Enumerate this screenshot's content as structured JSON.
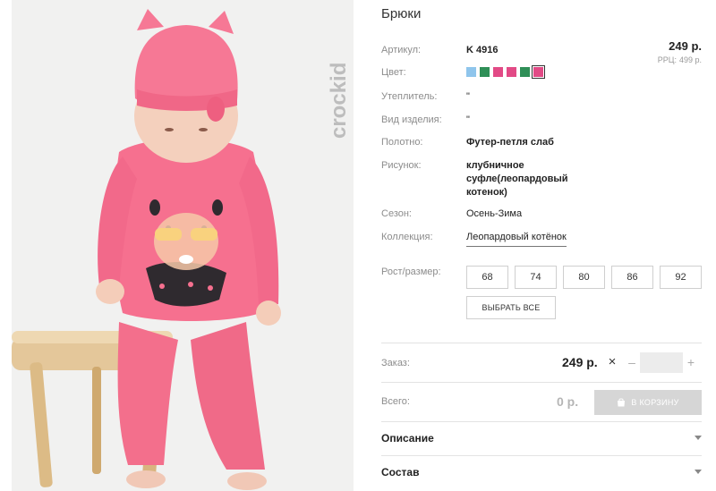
{
  "product": {
    "title": "Брюки",
    "price": "249 р.",
    "rrp_label": "РРЦ:",
    "rrp_value": "499 р."
  },
  "attributes": [
    {
      "label": "Артикул:",
      "value": "K 4916"
    },
    {
      "label": "Цвет:",
      "value": ""
    },
    {
      "label": "Утеплитель:",
      "value": "\""
    },
    {
      "label": "Вид изделия:",
      "value": "\""
    },
    {
      "label": "Полотно:",
      "value": "Футер-петля слаб"
    },
    {
      "label": "Рисунок:",
      "value": "клубничное суфле(леопардовый котенок)"
    },
    {
      "label": "Сезон:",
      "value": "Осень-Зима"
    },
    {
      "label": "Коллекция:",
      "value": "Леопардовый котёнок"
    }
  ],
  "swatches": [
    {
      "color": "#8fc5ec"
    },
    {
      "color": "#2f8f57"
    },
    {
      "color": "#e24a86"
    },
    {
      "color": "#e24a86"
    },
    {
      "color": "#2f8f57"
    },
    {
      "color": "#e24a86",
      "selected": true
    }
  ],
  "sizes": {
    "label": "Рост/размер:",
    "options": [
      "68",
      "74",
      "80",
      "86",
      "92"
    ],
    "select_all": "ВЫБРАТЬ ВСЕ"
  },
  "order": {
    "label": "Заказ:",
    "price": "249 р.",
    "times": "×",
    "minus": "–",
    "plus": "+",
    "quantity": ""
  },
  "total": {
    "label": "Всего:",
    "value": "0 р.",
    "cart_button": "В КОРЗИНУ"
  },
  "accordions": [
    {
      "title": "Описание"
    },
    {
      "title": "Состав"
    }
  ],
  "brand": {
    "logo_text": "crockid"
  },
  "colors": {
    "photo_bg": "#f1f1f0",
    "garment_pink": "#f36f8c",
    "button_disabled": "#d6d6d6"
  },
  "icons": {
    "cart": "shopping-bag-icon",
    "accordion": "triangle-down-icon"
  }
}
